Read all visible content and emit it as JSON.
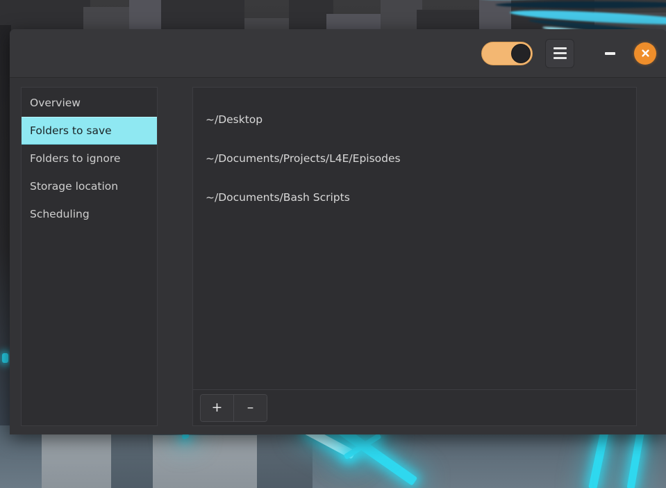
{
  "window": {
    "title": "",
    "titlebar": {
      "toggle": {
        "name": "enable-toggle",
        "state": "on",
        "accent": "#f3b772"
      },
      "menu_button_label": "≡",
      "minimize_label": "–",
      "close_label": "✕",
      "close_color": "#ef8e2b"
    }
  },
  "sidebar": {
    "items": [
      {
        "label": "Overview",
        "selected": false
      },
      {
        "label": "Folders to save",
        "selected": true
      },
      {
        "label": "Folders to ignore",
        "selected": false
      },
      {
        "label": "Storage location",
        "selected": false
      },
      {
        "label": "Scheduling",
        "selected": false
      }
    ],
    "selected_color": "#8fe8f2"
  },
  "content": {
    "folders": [
      {
        "path": "~/Desktop"
      },
      {
        "path": "~/Documents/Projects/L4E/Episodes"
      },
      {
        "path": "~/Documents/Bash Scripts"
      }
    ],
    "toolbar": {
      "add_label": "+",
      "remove_label": "–"
    }
  },
  "desktop": {
    "wallpaper_accent": "#2fd8ef",
    "wallpaper_base": "#2b2b2d"
  }
}
